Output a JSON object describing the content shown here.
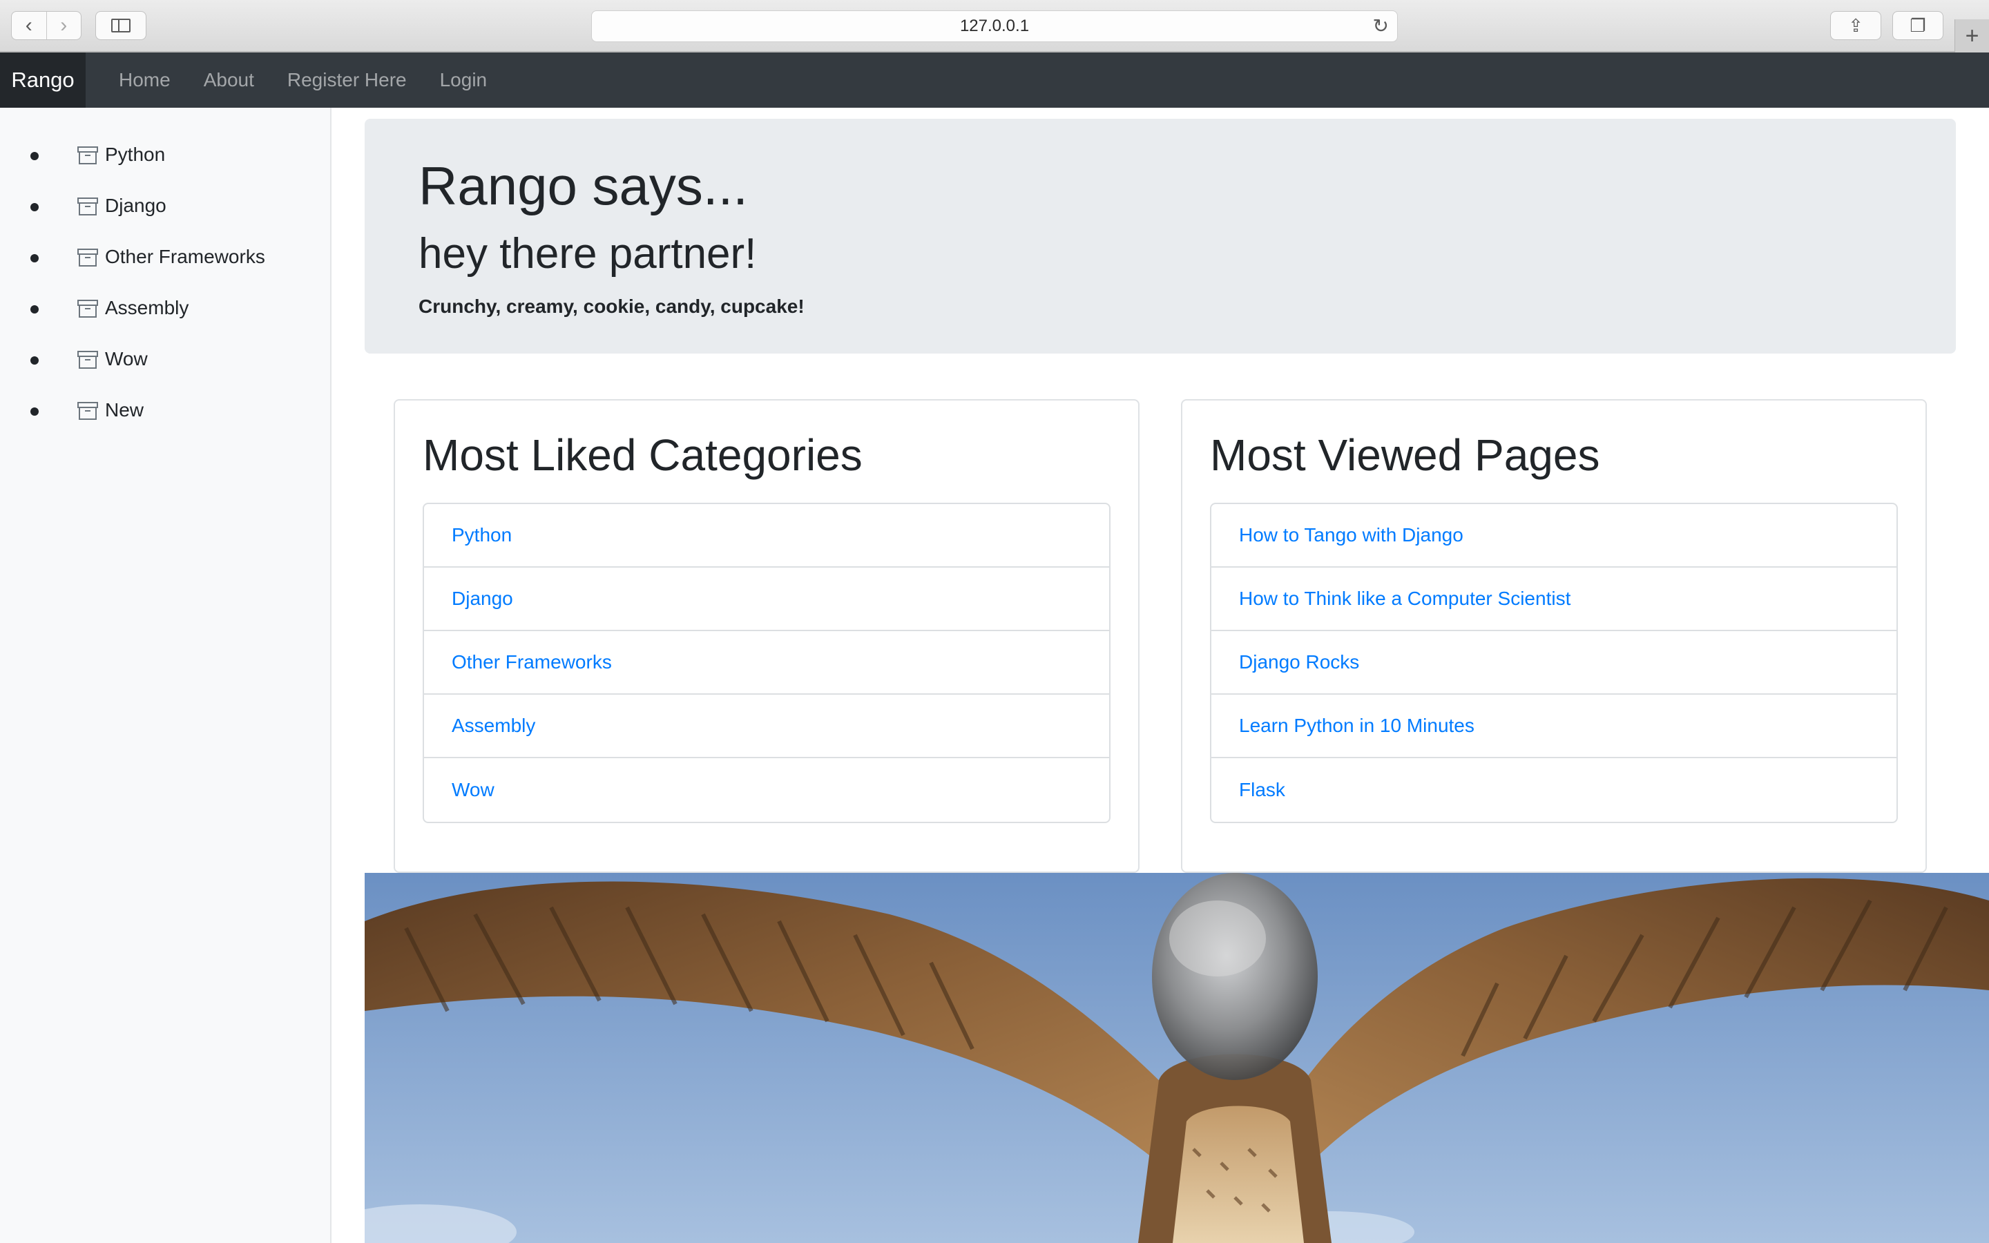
{
  "browser": {
    "url": "127.0.0.1",
    "back_glyph": "‹",
    "forward_glyph": "›",
    "share_glyph": "⇪",
    "tabs_glyph": "❐",
    "new_tab_glyph": "+",
    "reload_glyph": "↻"
  },
  "navbar": {
    "brand": "Rango",
    "links": [
      "Home",
      "About",
      "Register Here",
      "Login"
    ]
  },
  "sidebar": {
    "categories": [
      "Python",
      "Django",
      "Other Frameworks",
      "Assembly",
      "Wow",
      "New"
    ]
  },
  "jumbotron": {
    "title": "Rango says...",
    "subtitle": "hey there partner!",
    "tagline": "Crunchy, creamy, cookie, candy, cupcake!"
  },
  "liked_categories": {
    "title": "Most Liked Categories",
    "items": [
      "Python",
      "Django",
      "Other Frameworks",
      "Assembly",
      "Wow"
    ]
  },
  "viewed_pages": {
    "title": "Most Viewed Pages",
    "items": [
      "How to Tango with Django",
      "How to Think like a Computer Scientist",
      "Django Rocks",
      "Learn Python in 10 Minutes",
      "Flask"
    ]
  },
  "colors": {
    "navbar": "#343a40",
    "link": "#007bff",
    "jumbotron": "#e9ecef",
    "sky": "#8fb0d8",
    "feather": "#7a5533"
  }
}
